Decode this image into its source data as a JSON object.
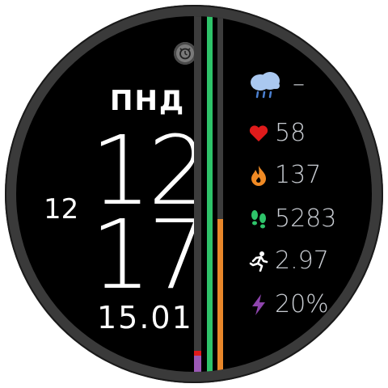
{
  "time": {
    "day": "ПНД",
    "hour": "12",
    "minute": "17",
    "second": "12",
    "date": "15.01"
  },
  "metrics": {
    "weather": {
      "value": "–",
      "icon": "cloud-rain-icon"
    },
    "heart_rate": {
      "value": "58",
      "icon": "heart-icon"
    },
    "calories": {
      "value": "137",
      "icon": "flame-icon"
    },
    "steps": {
      "value": "5283",
      "icon": "footprints-icon"
    },
    "distance": {
      "value": "2.97",
      "icon": "runner-icon"
    },
    "battery": {
      "value": "20%",
      "icon": "lightning-icon"
    }
  },
  "progress": {
    "left_bar": {
      "fraction": 0.2,
      "color": "#9b59b6",
      "marker_color": "#e01b1b"
    },
    "green_bar": {
      "fraction": 1.0,
      "color": "#2ec46a"
    },
    "orange_bar": {
      "fraction": 0.58,
      "color": "#e8872a"
    }
  },
  "colors": {
    "heart": "#e01b1b",
    "flame": "#f08a24",
    "steps": "#2ec46a",
    "lightning": "#8e44ad",
    "weather": "#aac8f0"
  }
}
